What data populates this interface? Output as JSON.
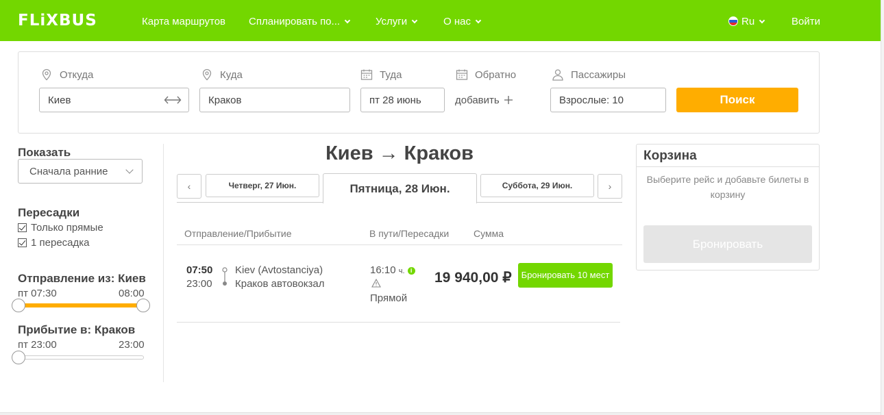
{
  "header": {
    "logo": "FLiXBUS",
    "nav": {
      "route_map": "Карта маршрутов",
      "plan_trip": "Спланировать по...",
      "services": "Услуги",
      "about": "О нас"
    },
    "language": "Ru",
    "login": "Войти"
  },
  "search": {
    "from_label": "Откуда",
    "from_value": "Киев",
    "to_label": "Куда",
    "to_value": "Краков",
    "depart_label": "Туда",
    "depart_value": "пт 28 июнь",
    "return_label": "Обратно",
    "return_add": "добавить",
    "passengers_label": "Пассажиры",
    "passengers_value": "Взрослые: 10",
    "search_button": "Поиск"
  },
  "sidebar": {
    "show_title": "Показать",
    "sort_value": "Сначала ранние",
    "transfers_title": "Пересадки",
    "transfers": [
      "Только прямые",
      "1 пересадка"
    ],
    "departure_title": "Отправление из: Киев",
    "departure_min": "пт 07:30",
    "departure_max": "08:00",
    "arrival_title": "Прибытие в: Краков",
    "arrival_min": "пт 23:00",
    "arrival_max": "23:00"
  },
  "results": {
    "route_title": "Киев → Краков",
    "prev_arrow": "‹",
    "next_arrow": "›",
    "dates": {
      "prev": "Четверг, 27 Июн.",
      "active": "Пятница, 28 Июн.",
      "next": "Суббота, 29 Июн."
    },
    "columns": {
      "depart_arrive": "Отправление/Прибытие",
      "duration": "В пути/Пересадки",
      "sum": "Сумма"
    },
    "trip": {
      "depart_time": "07:50",
      "arrive_time": "23:00",
      "depart_station": "Kiev (Avtostanciya)",
      "arrive_station": "Краков автовокзал",
      "duration": "16:10",
      "duration_unit": "ч.",
      "transfer_type": "Прямой",
      "price": "19 940,00 ₽",
      "book_button": "Бронировать 10 мест"
    }
  },
  "cart": {
    "title": "Корзина",
    "message": "Выберите рейс и добавьте билеты в корзину",
    "book_button": "Бронировать"
  },
  "colors": {
    "brand": "#73d700",
    "accent": "#ffad00"
  }
}
